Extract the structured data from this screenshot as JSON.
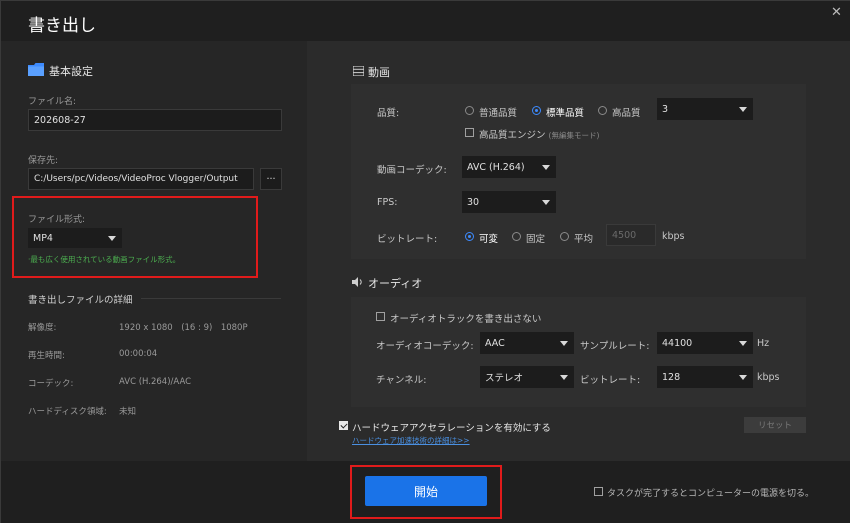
{
  "window": {
    "title": "書き出し"
  },
  "left": {
    "section_title": "基本設定",
    "file_name": {
      "label": "ファイル名:",
      "value": "202608-27"
    },
    "save_path": {
      "label": "保存先:",
      "value": "C:/Users/pc/Videos/VideoProc Vlogger/Output",
      "browse": "···"
    },
    "format": {
      "label": "ファイル形式:",
      "value": "MP4",
      "hint": "·最も広く使用されている動画ファイル形式。"
    },
    "details": {
      "title": "書き出しファイルの詳細",
      "rows": [
        {
          "key": "解像度:",
          "value": "1920 x 1080　(16 : 9)　1080P"
        },
        {
          "key": "再生時間:",
          "value": "00:00:04"
        },
        {
          "key": "コーデック:",
          "value": "AVC (H.264)/AAC"
        },
        {
          "key": "ハードディスク領域:",
          "value": "未知"
        }
      ]
    }
  },
  "video": {
    "section_title": "動画",
    "quality": {
      "label": "品質:",
      "options": [
        "普通品質",
        "標準品質",
        "高品質"
      ],
      "selected": "標準品質",
      "level": "3"
    },
    "hq_engine": {
      "label": "高品質エンジン",
      "note": "(無編集モード)",
      "checked": false
    },
    "codec": {
      "label": "動画コーデック:",
      "value": "AVC (H.264)"
    },
    "fps": {
      "label": "FPS:",
      "value": "30"
    },
    "bitrate": {
      "label": "ビットレート:",
      "options": [
        "可変",
        "固定",
        "平均"
      ],
      "selected": "可変",
      "value": "4500",
      "unit": "kbps"
    }
  },
  "audio": {
    "section_title": "オーディオ",
    "no_audio": {
      "label": "オーディオトラックを書き出さない",
      "checked": false
    },
    "codec": {
      "label": "オーディオコーデック:",
      "value": "AAC"
    },
    "sample_rate": {
      "label": "サンプルレート:",
      "value": "44100",
      "unit": "Hz"
    },
    "channel": {
      "label": "チャンネル:",
      "value": "ステレオ"
    },
    "bitrate": {
      "label": "ビットレート:",
      "value": "128",
      "unit": "kbps"
    }
  },
  "hardware": {
    "label": "ハードウェアアクセラレーションを有効にする",
    "checked": true,
    "link": "ハードウェア加速技術の詳細は>>",
    "reset": "リセット"
  },
  "footer": {
    "start": "開始",
    "shutdown": "タスクが完了するとコンピューターの電源を切る。",
    "shutdown_checked": false
  },
  "colors": {
    "accent": "#3d8bff",
    "start_button": "#1a73e8",
    "highlight": "#e01b1b",
    "hint": "#4caf50",
    "link": "#4a90e2"
  }
}
